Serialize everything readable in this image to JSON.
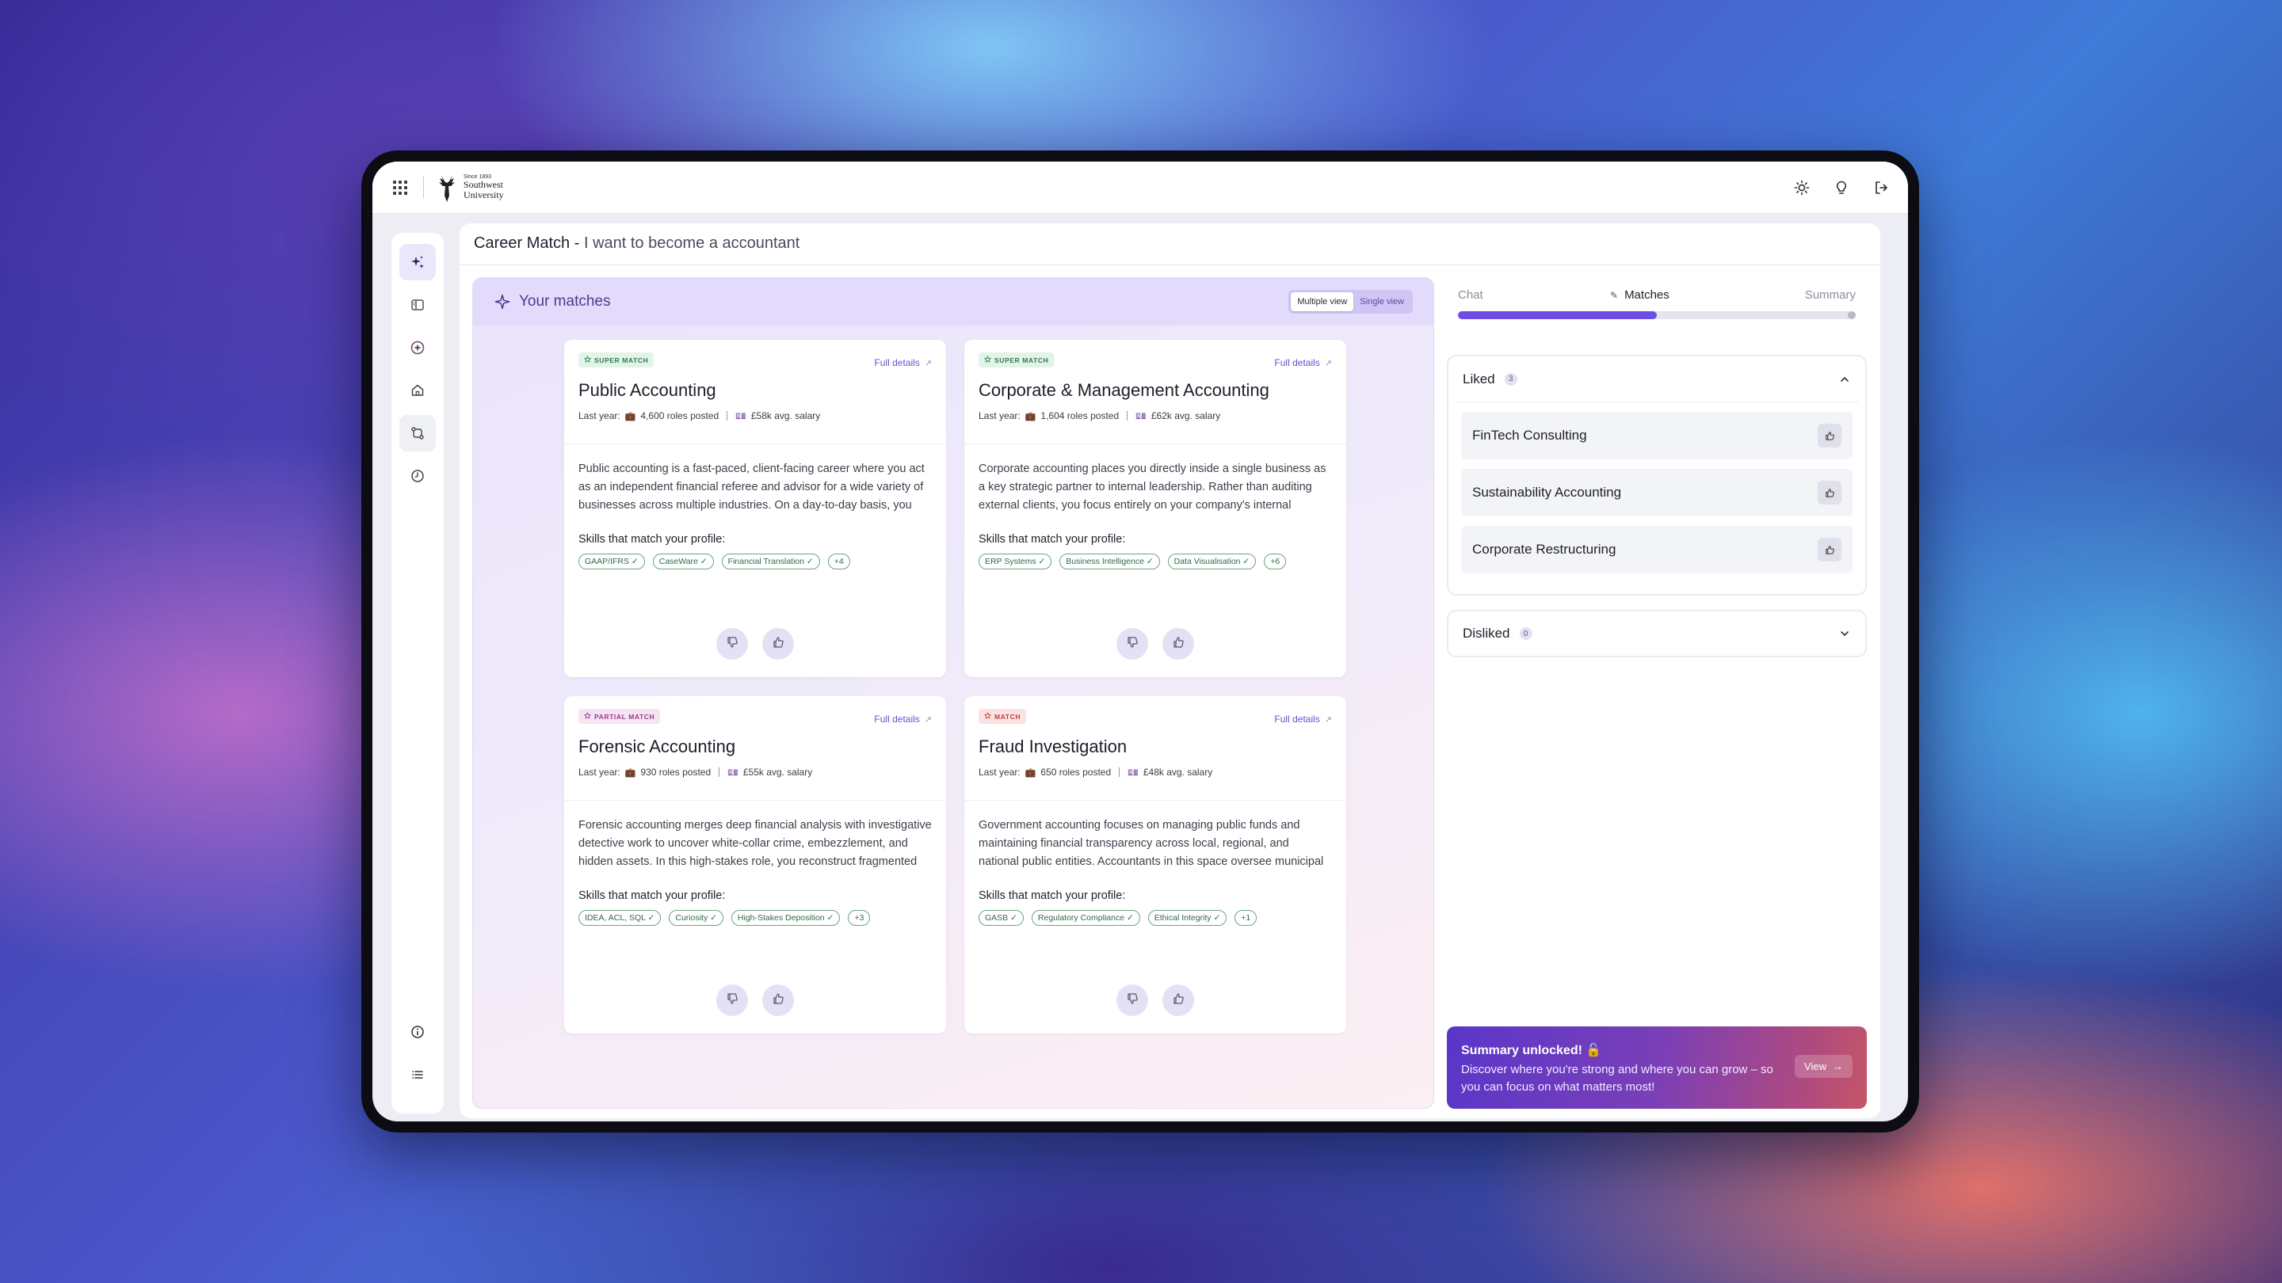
{
  "logo": {
    "small": "Since 1893",
    "name_line1": "Southwest",
    "name_line2": "University"
  },
  "header": {
    "title": "Career Match",
    "separator": "-",
    "subtitle": "I want to become a accountant"
  },
  "matches_panel": {
    "title": "Your matches",
    "view_toggle": {
      "multiple": "Multiple view",
      "single": "Single view",
      "selected": "Multiple view"
    }
  },
  "cards": [
    {
      "badge": "SUPER MATCH",
      "badge_colors": {
        "bg": "#e2f3e8",
        "fg": "#2f7a4c"
      },
      "full_details": "Full details",
      "title": "Public Accounting",
      "meta_prefix": "Last year:",
      "roles": "4,600 roles posted",
      "salary": "£58k avg. salary",
      "description": "Public accounting is a fast-paced, client-facing career where you act as an independent financial referee and advisor for a wide variety of businesses across multiple industries. On a day-to-day basis, you alternate between auditing corporate financ...",
      "skills_label": "Skills that match your profile:",
      "skills": [
        "GAAP/IFRS ✓",
        "CaseWare ✓",
        "Financial Translation ✓",
        "+4"
      ]
    },
    {
      "badge": "SUPER MATCH",
      "badge_colors": {
        "bg": "#e2f3e8",
        "fg": "#2f7a4c"
      },
      "full_details": "Full details",
      "title": "Corporate & Management Accounting",
      "meta_prefix": "Last year:",
      "roles": "1,604 roles posted",
      "salary": "£62k avg. salary",
      "description": "Corporate accounting places you directly inside a single business as a key strategic partner to internal leadership. Rather than auditing external clients, you focus entirely on your company's internal financial health by analyzing performance...",
      "skills_label": "Skills that match your profile:",
      "skills": [
        "ERP Systems ✓",
        "Business Intelligence ✓",
        "Data Visualisation ✓",
        "+6"
      ]
    },
    {
      "badge": "PARTIAL MATCH",
      "badge_colors": {
        "bg": "#f6e4f3",
        "fg": "#9b3c8d"
      },
      "full_details": "Full details",
      "title": "Forensic Accounting",
      "meta_prefix": "Last year:",
      "roles": "930 roles posted",
      "salary": "£55k avg. salary",
      "description": "Forensic accounting merges deep financial analysis with investigative detective work to uncover white-collar crime, embezzlement, and hidden assets. In this high-stakes role, you reconstruct fragmented financial trails, analyze suspicious tra...",
      "skills_label": "Skills that match your profile:",
      "skills": [
        "IDEA, ACL, SQL ✓",
        "Curiosity ✓",
        "High-Stakes Deposition ✓",
        "+3"
      ]
    },
    {
      "badge": "MATCH",
      "badge_colors": {
        "bg": "#fbe3e3",
        "fg": "#c0403f"
      },
      "full_details": "Full details",
      "title": "Fraud Investigation",
      "meta_prefix": "Last year:",
      "roles": "650 roles posted",
      "salary": "£48k avg. salary",
      "description": "Government accounting focuses on managing public funds and maintaining financial transparency across local, regional, and national public entities. Accountants in this space oversee municipal budgets, audit state agencies, track grant allocatio...",
      "skills_label": "Skills that match your profile:",
      "skills": [
        "GASB ✓",
        "Regulatory Compliance ✓",
        "Ethical Integrity ✓",
        "+1"
      ]
    }
  ],
  "steps": {
    "chat": "Chat",
    "matches": "Matches",
    "summary": "Summary",
    "progress": 0.5
  },
  "liked": {
    "label": "Liked",
    "count": "3",
    "items": [
      "FinTech Consulting",
      "Sustainability Accounting",
      "Corporate Restructuring"
    ]
  },
  "disliked": {
    "label": "Disliked",
    "count": "0"
  },
  "summary_banner": {
    "title": "Summary unlocked! 🔓",
    "text": "Discover where you're strong and where you can grow – so you can focus on what matters most!",
    "button": "View"
  },
  "colors": {
    "accent": "#6c4ee2",
    "accent_text": "#6a4fd0",
    "chip_green": "#2f6a46"
  }
}
